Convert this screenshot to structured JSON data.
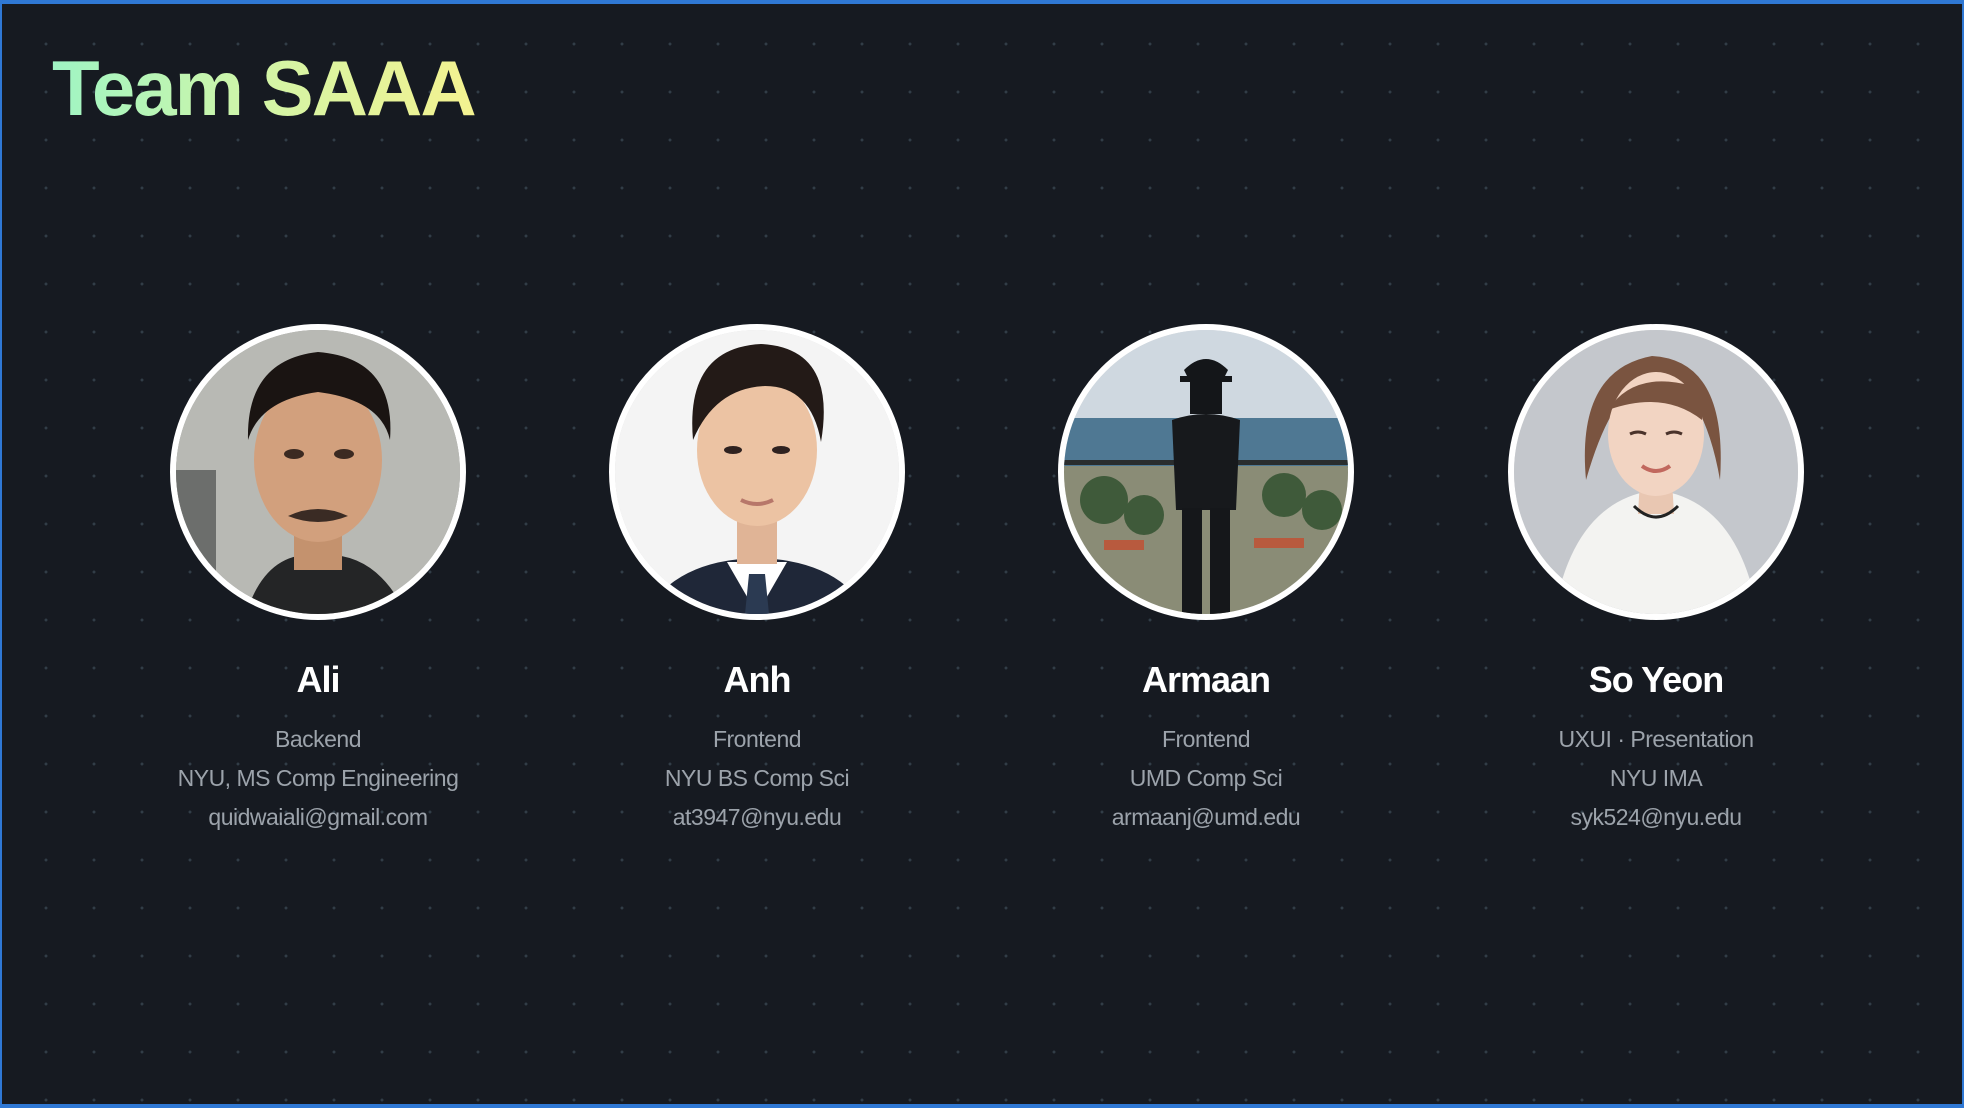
{
  "title": "Team SAAA",
  "members": [
    {
      "name": "Ali",
      "role": "Backend",
      "school": "NYU, MS Comp Engineering",
      "email": "quidwaiali@gmail.com",
      "avatar_icon": "person-portrait-photo"
    },
    {
      "name": "Anh",
      "role": "Frontend",
      "school": "NYU BS Comp Sci",
      "email": "at3947@nyu.edu",
      "avatar_icon": "person-portrait-photo"
    },
    {
      "name": "Armaan",
      "role": "Frontend",
      "school": "UMD Comp Sci",
      "email": "armaanj@umd.edu",
      "avatar_icon": "beach-silhouette-photo"
    },
    {
      "name": "So Yeon",
      "role": "UXUI · Presentation",
      "school": "NYU IMA",
      "email": "syk524@nyu.edu",
      "avatar_icon": "person-portrait-photo"
    }
  ],
  "colors": {
    "background": "#161a21",
    "title_gradient_start": "#9ff5c4",
    "title_gradient_end": "#f4f290",
    "frame_border": "#2f78d4",
    "secondary_text": "#9ca3ab"
  }
}
